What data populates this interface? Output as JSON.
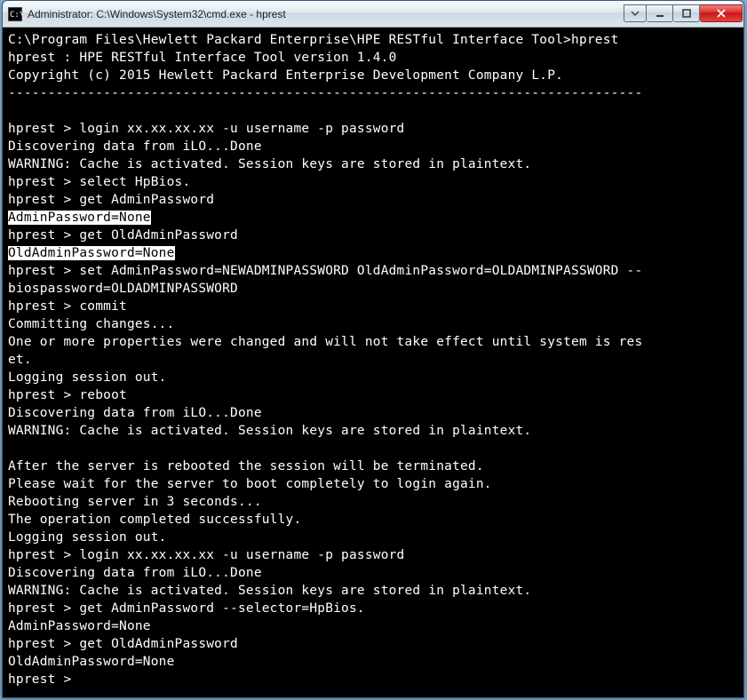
{
  "window": {
    "title": "Administrator: C:\\Windows\\System32\\cmd.exe - hprest"
  },
  "terminal": {
    "l01": "C:\\Program Files\\Hewlett Packard Enterprise\\HPE RESTful Interface Tool>hprest",
    "l02": "hprest : HPE RESTful Interface Tool version 1.4.0",
    "l03": "Copyright (c) 2015 Hewlett Packard Enterprise Development Company L.P.",
    "l04": "--------------------------------------------------------------------------------",
    "l05": "",
    "l06": "hprest > login xx.xx.xx.xx -u username -p password",
    "l07": "Discovering data from iLO...Done",
    "l08": "WARNING: Cache is activated. Session keys are stored in plaintext.",
    "l09": "hprest > select HpBios.",
    "l10": "hprest > get AdminPassword",
    "l11": "AdminPassword=None",
    "l12": "hprest > get OldAdminPassword",
    "l13": "OldAdminPassword=None",
    "l14": "hprest > set AdminPassword=NEWADMINPASSWORD OldAdminPassword=OLDADMINPASSWORD --",
    "l15": "biospassword=OLDADMINPASSWORD",
    "l16": "hprest > commit",
    "l17": "Committing changes...",
    "l18": "One or more properties were changed and will not take effect until system is res",
    "l19": "et.",
    "l20": "Logging session out.",
    "l21": "hprest > reboot",
    "l22": "Discovering data from iLO...Done",
    "l23": "WARNING: Cache is activated. Session keys are stored in plaintext.",
    "l24": "",
    "l25": "After the server is rebooted the session will be terminated.",
    "l26": "Please wait for the server to boot completely to login again.",
    "l27": "Rebooting server in 3 seconds...",
    "l28": "The operation completed successfully.",
    "l29": "Logging session out.",
    "l30": "hprest > login xx.xx.xx.xx -u username -p password",
    "l31": "Discovering data from iLO...Done",
    "l32": "WARNING: Cache is activated. Session keys are stored in plaintext.",
    "l33": "hprest > get AdminPassword --selector=HpBios.",
    "l34": "AdminPassword=None",
    "l35": "hprest > get OldAdminPassword",
    "l36": "OldAdminPassword=None",
    "l37": "hprest >"
  }
}
